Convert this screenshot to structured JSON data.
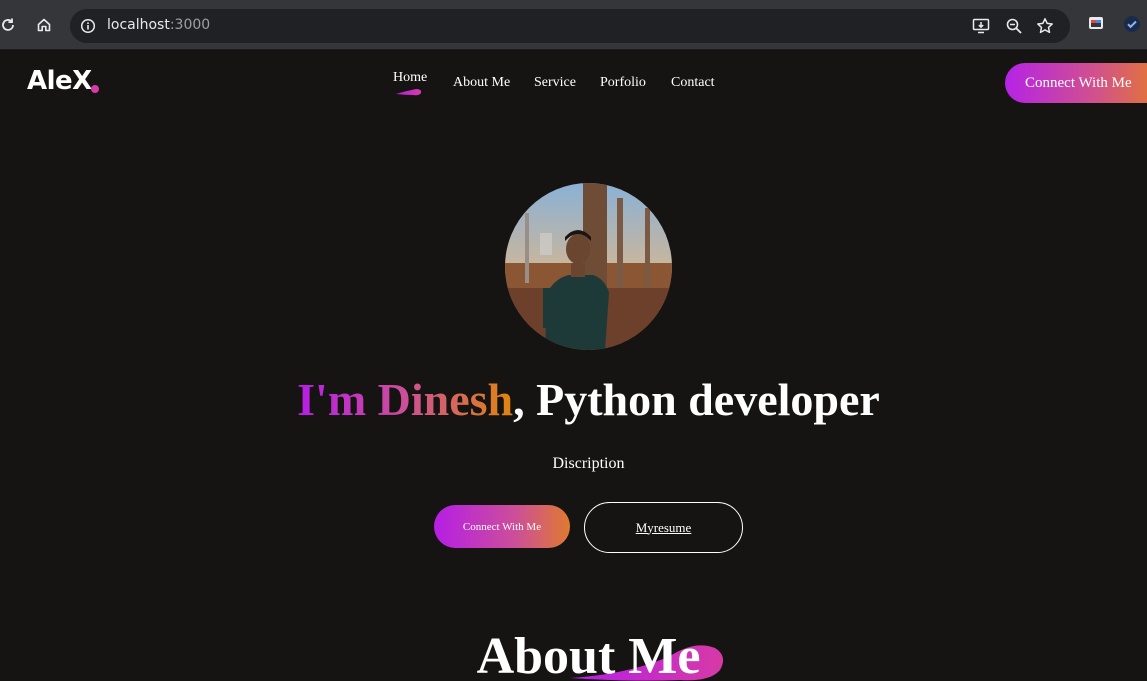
{
  "browser": {
    "url_host": "localhost",
    "url_port": ":3000"
  },
  "site": {
    "logo": "AleX",
    "nav": [
      {
        "label": "Home",
        "active": true
      },
      {
        "label": "About Me",
        "active": false
      },
      {
        "label": "Service",
        "active": false
      },
      {
        "label": "Porfolio",
        "active": false
      },
      {
        "label": "Contact",
        "active": false
      }
    ],
    "connect_button": "Connect With Me",
    "hero": {
      "intro": "I'm Dinesh",
      "role": ", Python developer",
      "description": "Discription",
      "primary_button": "Connect With Me",
      "secondary_button": "Myresume"
    },
    "about_title": "About Me"
  },
  "colors": {
    "background": "#161413",
    "gradient_start": "#b51ee6",
    "gradient_mid": "#cc4f98",
    "gradient_end": "#e0850f"
  }
}
